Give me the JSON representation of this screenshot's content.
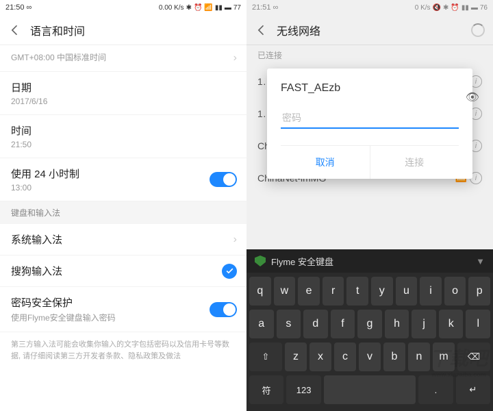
{
  "left": {
    "status": {
      "time": "21:50",
      "net": "0.00 K/s",
      "battery": "77"
    },
    "header": "语言和时间",
    "tz": "GMT+08:00 中国标准时间",
    "date": {
      "label": "日期",
      "value": "2017/6/16"
    },
    "time": {
      "label": "时间",
      "value": "21:50"
    },
    "fmt24": {
      "label": "使用 24 小时制",
      "example": "13:00"
    },
    "section": "键盘和输入法",
    "sysime": "系统输入法",
    "sogou": "搜狗输入法",
    "pwsafe": {
      "label": "密码安全保护",
      "desc": "使用Flyme安全键盘输入密码"
    },
    "disclaimer": "第三方输入法可能会收集你输入的文字包括密码以及信用卡号等数据, 请仔细阅读第三方开发者条款、隐私政策及做法"
  },
  "right": {
    "status": {
      "time": "21:51",
      "net": "0 K/s",
      "battery": "76"
    },
    "header": "无线网络",
    "connected": "已连接",
    "dialog": {
      "ssid": "FAST_AEzb",
      "placeholder": "密码",
      "cancel": "取消",
      "connect": "连接"
    },
    "bgnets": [
      "1…",
      "1…",
      "ChinaNet-…",
      "ChinaNet-imMG"
    ],
    "kb": {
      "title": "Flyme 安全键盘",
      "rows": [
        [
          "q",
          "w",
          "e",
          "r",
          "t",
          "y",
          "u",
          "i",
          "o",
          "p"
        ],
        [
          "a",
          "s",
          "d",
          "f",
          "g",
          "h",
          "j",
          "k",
          "l"
        ],
        [
          "⇧",
          "z",
          "x",
          "c",
          "v",
          "b",
          "n",
          "m",
          "⌫"
        ]
      ],
      "bottom": {
        "sym": "符",
        "num": "123",
        "enter": "↵"
      }
    }
  },
  "watermark": {
    "big": "下载吧",
    "url": "www.xiazaiba.com"
  }
}
